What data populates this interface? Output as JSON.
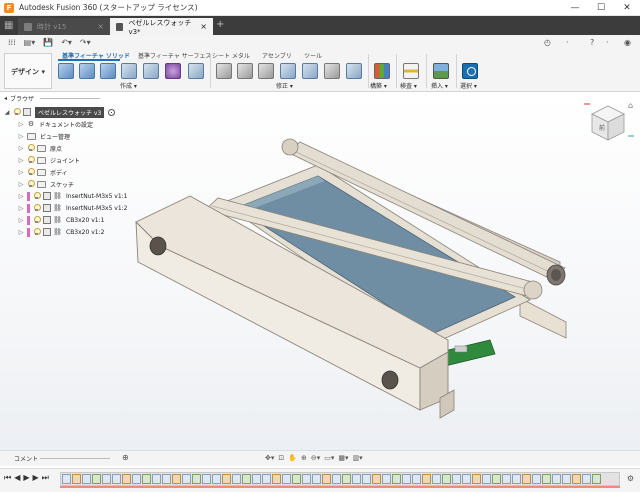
{
  "window": {
    "title": "Autodesk Fusion 360 (スタートアップ ライセンス)",
    "controls": [
      "—",
      "☐",
      "✕"
    ]
  },
  "tabs": [
    {
      "label": "時計 v15",
      "active": false
    },
    {
      "label": "ベゼルレスウォッチ v3*",
      "active": true
    }
  ],
  "ribbon": {
    "workspace": "デザイン",
    "tabs": [
      "基準フィーチャ ソリッド",
      "基準フィーチャ サーフェス",
      "シート メタル",
      "アセンブリ",
      "ツール"
    ],
    "groups": [
      "作成",
      "修正",
      "構築",
      "検査",
      "挿入",
      "選択"
    ]
  },
  "browser": {
    "title": "ブラウザ",
    "root": "ベゼルレスウォッチ v3",
    "items": [
      {
        "label": "ドキュメントの設定",
        "kind": "gear"
      },
      {
        "label": "ビュー管理",
        "kind": "folder"
      },
      {
        "label": "原点",
        "kind": "folder"
      },
      {
        "label": "ジョイント",
        "kind": "folder"
      },
      {
        "label": "ボディ",
        "kind": "folder"
      },
      {
        "label": "スケッチ",
        "kind": "folder"
      },
      {
        "label": "InsertNut-M3x5 v1:1",
        "kind": "component"
      },
      {
        "label": "InsertNut-M3x5 v1:2",
        "kind": "component"
      },
      {
        "label": "CB3x20 v1:1",
        "kind": "component"
      },
      {
        "label": "CB3x20 v1:2",
        "kind": "component"
      }
    ]
  },
  "viewcube": {
    "face_label": "前"
  },
  "comments": {
    "label": "コメント"
  },
  "colors": {
    "accent": "#1f6fb3",
    "select": "#1b6fae",
    "tabbar": "#3c3c3c"
  }
}
